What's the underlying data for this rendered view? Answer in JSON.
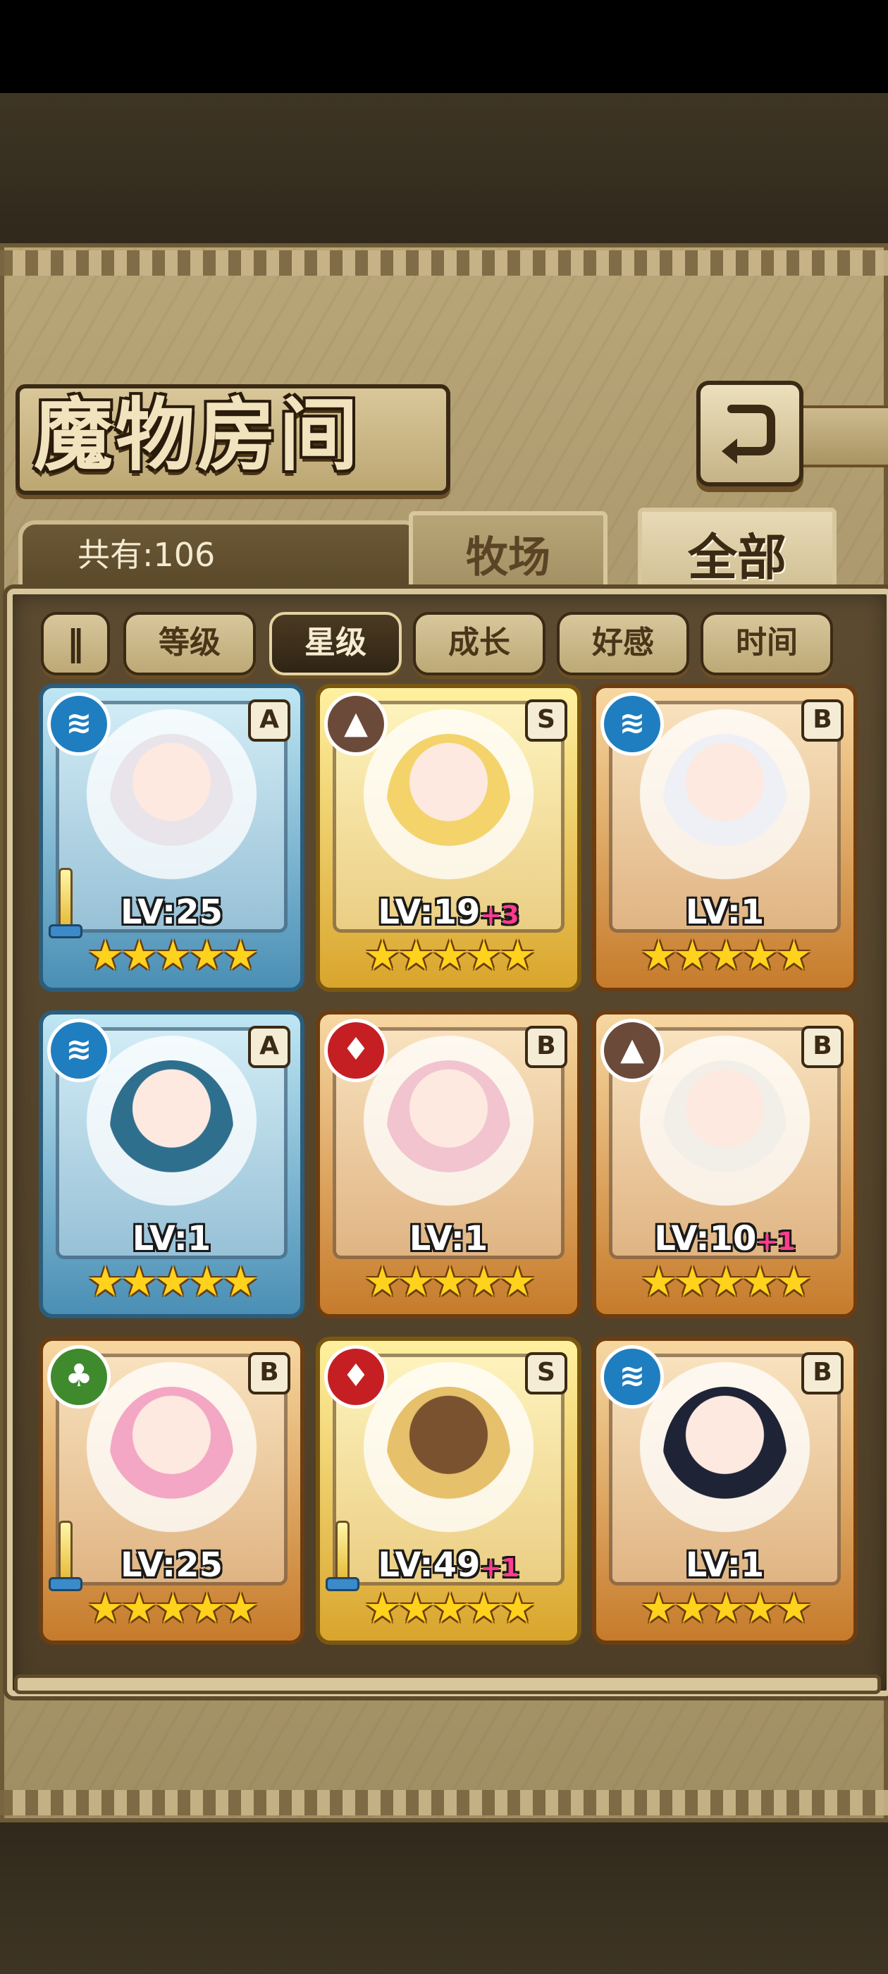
{
  "header": {
    "title": "魔物房间",
    "count_label": "共有:106",
    "back_icon": "↰"
  },
  "tabs": [
    {
      "label": "牧场",
      "selected": false
    },
    {
      "label": "全部",
      "selected": true
    }
  ],
  "sort": {
    "toggle_label": "‖",
    "buttons": [
      {
        "label": "等级",
        "selected": false
      },
      {
        "label": "星级",
        "selected": true
      },
      {
        "label": "成长",
        "selected": false
      },
      {
        "label": "好感",
        "selected": false
      },
      {
        "label": "时间",
        "selected": false
      }
    ]
  },
  "cards": [
    {
      "element": "water",
      "element_icon": "≋",
      "rank": "A",
      "frame": "blue",
      "level": "LV:25",
      "bonus": "",
      "stars": "★★★★★",
      "weapon": true
    },
    {
      "element": "earth",
      "element_icon": "▲",
      "rank": "S",
      "frame": "gold",
      "level": "LV:19",
      "bonus": "+3",
      "stars": "★★★★★",
      "weapon": false
    },
    {
      "element": "water",
      "element_icon": "≋",
      "rank": "B",
      "frame": "orange",
      "level": "LV:1",
      "bonus": "",
      "stars": "★★★★★",
      "weapon": false
    },
    {
      "element": "water",
      "element_icon": "≋",
      "rank": "A",
      "frame": "blue",
      "level": "LV:1",
      "bonus": "",
      "stars": "★★★★★",
      "weapon": false
    },
    {
      "element": "fire",
      "element_icon": "♦",
      "rank": "B",
      "frame": "orange",
      "level": "LV:1",
      "bonus": "",
      "stars": "★★★★★",
      "weapon": false
    },
    {
      "element": "earth",
      "element_icon": "▲",
      "rank": "B",
      "frame": "orange",
      "level": "LV:10",
      "bonus": "+1",
      "stars": "★★★★★",
      "weapon": false
    },
    {
      "element": "wood",
      "element_icon": "♣",
      "rank": "B",
      "frame": "orange",
      "level": "LV:25",
      "bonus": "",
      "stars": "★★★★★",
      "weapon": true
    },
    {
      "element": "fire",
      "element_icon": "♦",
      "rank": "S",
      "frame": "gold",
      "level": "LV:49",
      "bonus": "+1",
      "stars": "★★★★★",
      "weapon": true
    },
    {
      "element": "water",
      "element_icon": "≋",
      "rank": "B",
      "frame": "orange",
      "level": "LV:1",
      "bonus": "",
      "stars": "★★★★★",
      "weapon": false
    }
  ]
}
